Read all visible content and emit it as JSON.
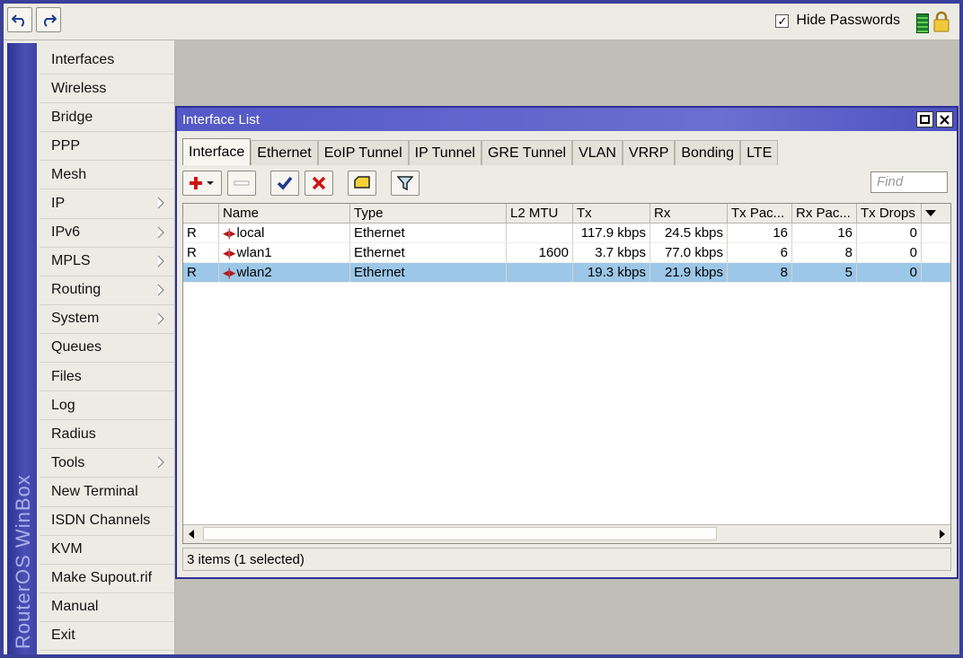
{
  "toolbar": {
    "hide_passwords_label": "Hide Passwords",
    "hide_passwords_checked": true
  },
  "brand": {
    "text": "RouterOS WinBox"
  },
  "menu": [
    {
      "label": "Interfaces",
      "sub": false
    },
    {
      "label": "Wireless",
      "sub": false
    },
    {
      "label": "Bridge",
      "sub": false
    },
    {
      "label": "PPP",
      "sub": false
    },
    {
      "label": "Mesh",
      "sub": false
    },
    {
      "label": "IP",
      "sub": true
    },
    {
      "label": "IPv6",
      "sub": true
    },
    {
      "label": "MPLS",
      "sub": true
    },
    {
      "label": "Routing",
      "sub": true
    },
    {
      "label": "System",
      "sub": true
    },
    {
      "label": "Queues",
      "sub": false
    },
    {
      "label": "Files",
      "sub": false
    },
    {
      "label": "Log",
      "sub": false
    },
    {
      "label": "Radius",
      "sub": false
    },
    {
      "label": "Tools",
      "sub": true
    },
    {
      "label": "New Terminal",
      "sub": false
    },
    {
      "label": "ISDN Channels",
      "sub": false
    },
    {
      "label": "KVM",
      "sub": false
    },
    {
      "label": "Make Supout.rif",
      "sub": false
    },
    {
      "label": "Manual",
      "sub": false
    },
    {
      "label": "Exit",
      "sub": false
    }
  ],
  "window": {
    "title": "Interface List",
    "tabs": [
      "Interface",
      "Ethernet",
      "EoIP Tunnel",
      "IP Tunnel",
      "GRE Tunnel",
      "VLAN",
      "VRRP",
      "Bonding",
      "LTE"
    ],
    "active_tab": 0,
    "find_placeholder": "Find",
    "columns": [
      "",
      "Name",
      "Type",
      "L2 MTU",
      "Tx",
      "Rx",
      "Tx Pac...",
      "Rx Pac...",
      "Tx Drops"
    ],
    "rows": [
      {
        "flag": "R",
        "name": "local",
        "type": "Ethernet",
        "l2mtu": "",
        "tx": "117.9 kbps",
        "rx": "24.5 kbps",
        "txp": "16",
        "rxp": "16",
        "txd": "0",
        "selected": false
      },
      {
        "flag": "R",
        "name": "wlan1",
        "type": "Ethernet",
        "l2mtu": "1600",
        "tx": "3.7 kbps",
        "rx": "77.0 kbps",
        "txp": "6",
        "rxp": "8",
        "txd": "0",
        "selected": false
      },
      {
        "flag": "R",
        "name": "wlan2",
        "type": "Ethernet",
        "l2mtu": "",
        "tx": "19.3 kbps",
        "rx": "21.9 kbps",
        "txp": "8",
        "rxp": "5",
        "txd": "0",
        "selected": true
      }
    ],
    "status": "3 items (1 selected)"
  }
}
